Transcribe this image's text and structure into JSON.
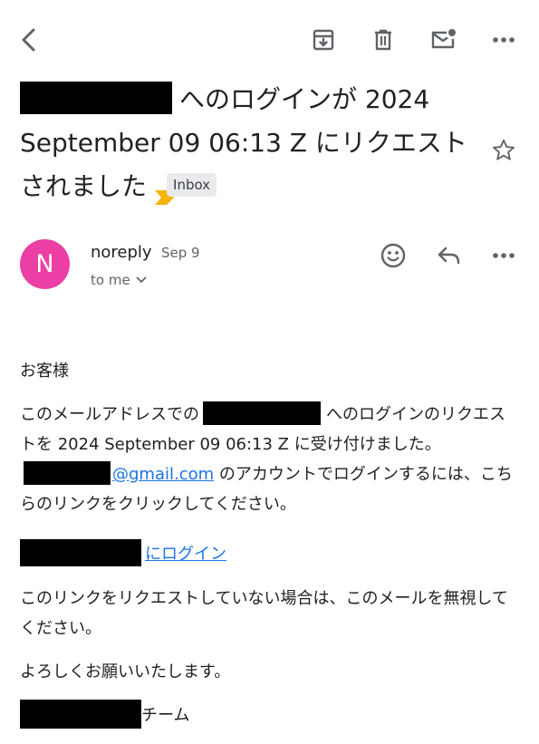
{
  "subject": {
    "text": "へのログインが 2024 September 09 06:13 Z にリクエストされました",
    "label": "Inbox"
  },
  "message": {
    "avatar_letter": "N",
    "avatar_color": "#ec3fa5",
    "sender": "noreply",
    "date": "Sep 9",
    "recipient": "to me"
  },
  "body": {
    "greeting": "お客様",
    "para1_a": "このメールアドレスでの",
    "para1_b": "へのログインのリクエストを 2024 September 09 06:13 Z に受け付けました。",
    "email_domain": "@gmail.com",
    "para1_c": " のアカウントでログインするには、こちらのリンクをクリックしてください。",
    "login_link": "にログイン",
    "para2": "このリンクをリクエストしていない場合は、このメールを無視してください。",
    "closing": "よろしくお願いいたします。",
    "team_suffix": "チーム"
  },
  "icons": {
    "back": "back-arrow-icon",
    "archive": "archive-icon",
    "delete": "trash-icon",
    "mark_unread": "mark-unread-icon",
    "more": "more-horizontal-icon",
    "star": "star-outline-icon",
    "emoji": "emoji-reaction-icon",
    "reply": "reply-icon",
    "chevron": "chevron-down-icon",
    "importance": "importance-marker-icon"
  },
  "colors": {
    "link": "#1a73e8",
    "importance": "#f4b400",
    "chip_bg": "#e8eaed"
  }
}
